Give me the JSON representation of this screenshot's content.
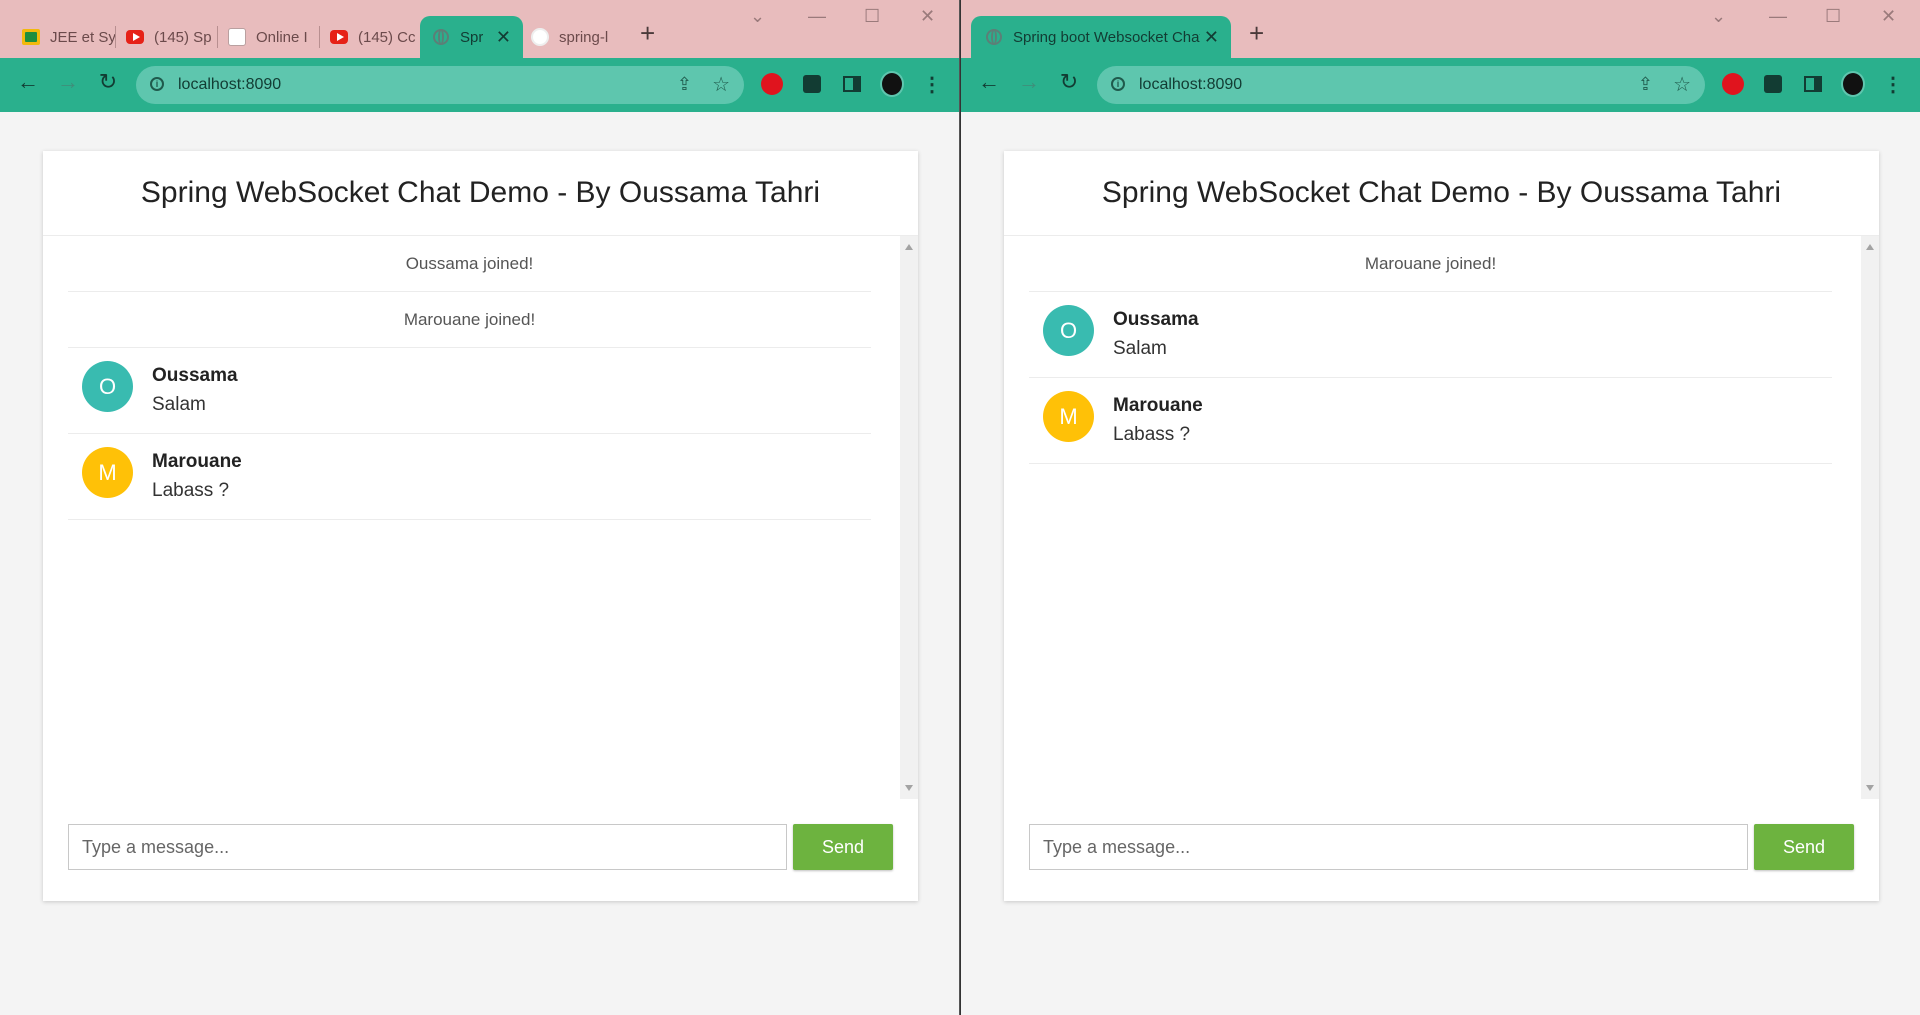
{
  "colors": {
    "avatar_oussama": "#39bbb0",
    "avatar_marouane": "#ffc107",
    "send_button": "#6db33f",
    "tabbar": "#e8bcbd",
    "toolbar": "#2ab08d"
  },
  "left": {
    "tabs": [
      {
        "title": "JEE et Sy",
        "icon": "classroom-icon"
      },
      {
        "title": "(145) Sp",
        "icon": "youtube-icon"
      },
      {
        "title": "Online I",
        "icon": "document-icon"
      },
      {
        "title": "(145) Cc",
        "icon": "youtube-icon"
      },
      {
        "title": "Spr",
        "icon": "globe-icon",
        "active": true
      },
      {
        "title": "spring-l",
        "icon": "github-icon"
      }
    ],
    "url": "localhost:8090",
    "title": "Spring WebSocket Chat Demo - By Oussama Tahri",
    "events": [
      "Oussama joined!",
      "Marouane joined!"
    ],
    "messages": [
      {
        "initial": "O",
        "sender": "Oussama",
        "text": "Salam"
      },
      {
        "initial": "M",
        "sender": "Marouane",
        "text": "Labass ?"
      }
    ],
    "input_placeholder": "Type a message...",
    "send_label": "Send"
  },
  "right": {
    "tabs": [
      {
        "title": "Spring boot Websocket Chat Ap",
        "icon": "globe-icon",
        "active": true
      }
    ],
    "url": "localhost:8090",
    "title": "Spring WebSocket Chat Demo - By Oussama Tahri",
    "events": [
      "Marouane joined!"
    ],
    "messages": [
      {
        "initial": "O",
        "sender": "Oussama",
        "text": "Salam"
      },
      {
        "initial": "M",
        "sender": "Marouane",
        "text": "Labass ?"
      }
    ],
    "input_placeholder": "Type a message...",
    "send_label": "Send"
  }
}
